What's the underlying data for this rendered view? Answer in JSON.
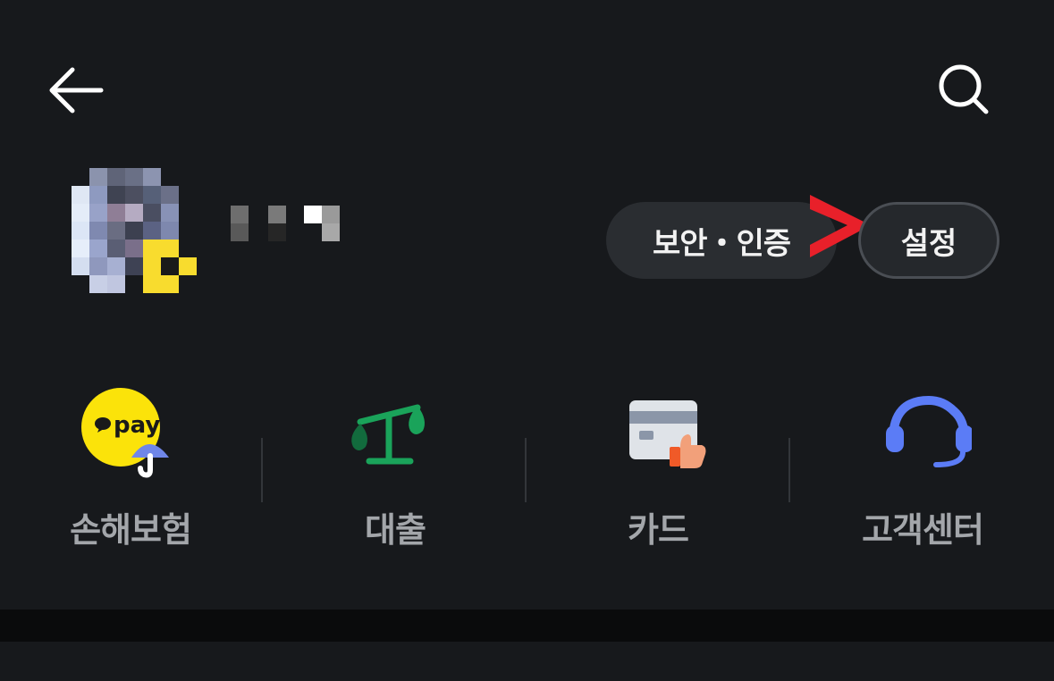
{
  "header": {
    "back_icon": "arrow-left-icon",
    "search_icon": "search-icon"
  },
  "profile": {
    "avatar": "pixelated-avatar"
  },
  "actions": {
    "security_label": "보안・인증",
    "settings_label": "설정"
  },
  "menu": [
    {
      "label": "손해보험",
      "icon": "pay-umbrella-icon"
    },
    {
      "label": "대출",
      "icon": "scale-icon"
    },
    {
      "label": "카드",
      "icon": "card-icon"
    },
    {
      "label": "고객센터",
      "icon": "headset-icon"
    }
  ],
  "colors": {
    "background": "#17191c",
    "pill": "#2a2d31",
    "label": "#a3a6aa",
    "annotation_arrow": "#e8202a"
  }
}
